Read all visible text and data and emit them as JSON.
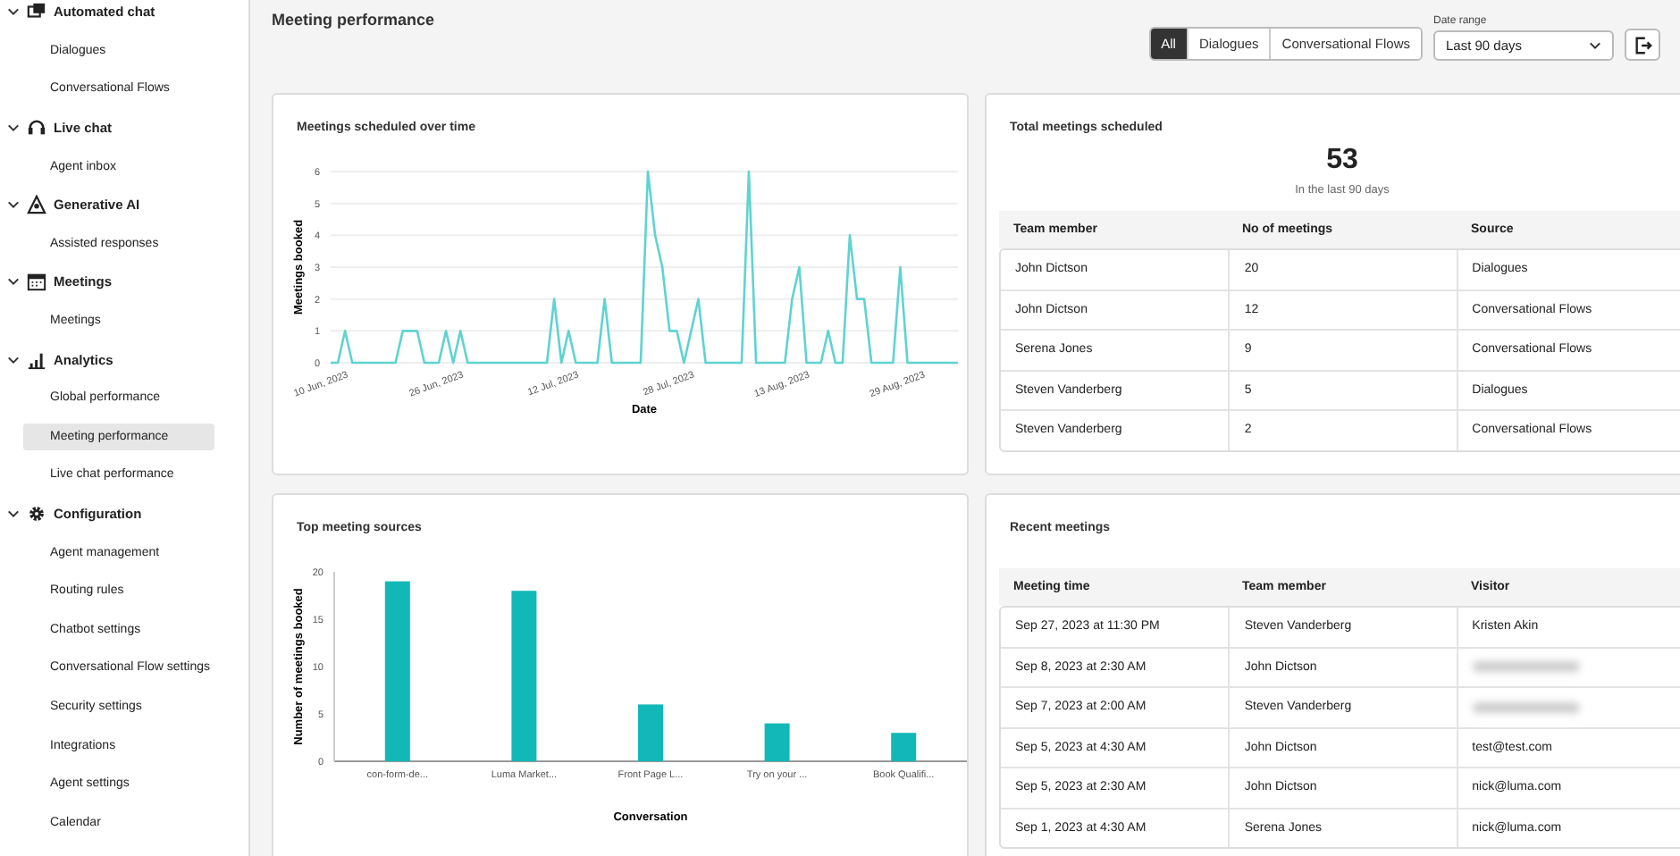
{
  "sidebar": {
    "groups": [
      {
        "label": "Automated chat",
        "expanded": true,
        "items": [
          {
            "label": "Dialogues",
            "selected": false
          },
          {
            "label": "Conversational Flows",
            "selected": false
          }
        ]
      },
      {
        "label": "Live chat",
        "expanded": true,
        "items": [
          {
            "label": "Agent inbox",
            "selected": false
          }
        ]
      },
      {
        "label": "Generative AI",
        "expanded": true,
        "items": [
          {
            "label": "Assisted responses",
            "selected": false
          }
        ]
      },
      {
        "label": "Meetings",
        "expanded": true,
        "items": [
          {
            "label": "Meetings",
            "selected": false
          }
        ]
      },
      {
        "label": "Analytics",
        "expanded": true,
        "items": [
          {
            "label": "Global performance",
            "selected": false
          },
          {
            "label": "Meeting performance",
            "selected": true
          },
          {
            "label": "Live chat performance",
            "selected": false
          }
        ]
      },
      {
        "label": "Configuration",
        "expanded": true,
        "items": [
          {
            "label": "Agent management",
            "selected": false
          },
          {
            "label": "Routing rules",
            "selected": false
          },
          {
            "label": "Chatbot settings",
            "selected": false
          },
          {
            "label": "Conversational Flow settings",
            "selected": false
          },
          {
            "label": "Security settings",
            "selected": false
          },
          {
            "label": "Integrations",
            "selected": false
          },
          {
            "label": "Agent settings",
            "selected": false
          },
          {
            "label": "Calendar",
            "selected": false
          }
        ]
      }
    ]
  },
  "header": {
    "title": "Meeting performance",
    "filters": [
      {
        "label": "All",
        "selected": true
      },
      {
        "label": "Dialogues",
        "selected": false
      },
      {
        "label": "Conversational Flows",
        "selected": false
      }
    ],
    "date_range": {
      "label": "Date range",
      "value": "Last 90 days"
    }
  },
  "meetings_over_time": {
    "title": "Meetings scheduled over time",
    "chart_data": {
      "type": "line",
      "xlabel": "Date",
      "ylabel": "Meetings booked",
      "categories": [
        null,
        null,
        "10 Jun, 2023",
        null,
        null,
        null,
        null,
        null,
        null,
        null,
        null,
        null,
        null,
        null,
        null,
        null,
        null,
        null,
        "26 Jun, 2023",
        null,
        null,
        null,
        null,
        null,
        null,
        null,
        null,
        null,
        null,
        null,
        null,
        null,
        null,
        null,
        "12 Jul, 2023",
        null,
        null,
        null,
        null,
        null,
        null,
        null,
        null,
        null,
        null,
        null,
        null,
        null,
        null,
        null,
        "28 Jul, 2023",
        null,
        null,
        null,
        null,
        null,
        null,
        null,
        null,
        null,
        null,
        null,
        null,
        null,
        null,
        null,
        "13 Aug, 2023",
        null,
        null,
        null,
        null,
        null,
        null,
        null,
        null,
        null,
        null,
        null,
        null,
        null,
        null,
        null,
        "29 Aug, 2023",
        null,
        null,
        null,
        null,
        null
      ],
      "series": [
        {
          "color": "#5fd3d0",
          "values": [
            0,
            0,
            1,
            0,
            0,
            0,
            0,
            0,
            0,
            0,
            1,
            1,
            1,
            0,
            0,
            0,
            1,
            0,
            1,
            0,
            0,
            0,
            0,
            0,
            0,
            0,
            0,
            0,
            0,
            0,
            0,
            2,
            0,
            1,
            0,
            0,
            0,
            0,
            2,
            0,
            0,
            0,
            0,
            0,
            6,
            4,
            3,
            1,
            1,
            0,
            1,
            2,
            0,
            0,
            0,
            0,
            0,
            0,
            6,
            0,
            0,
            0,
            0,
            0,
            2,
            3,
            0,
            0,
            0,
            1,
            0,
            0,
            4,
            2,
            2,
            0,
            0,
            0,
            0,
            3,
            0,
            0,
            0,
            0,
            0,
            0,
            0,
            0
          ]
        }
      ],
      "ylim": [
        0,
        6
      ],
      "grid": true,
      "yticks": [
        0,
        1,
        2,
        3,
        4,
        5,
        6
      ]
    }
  },
  "total_meetings": {
    "title": "Total meetings scheduled",
    "value": "53",
    "caption": "In the last 90 days",
    "table": {
      "columns": [
        "Team member",
        "No of meetings",
        "Source"
      ],
      "rows": [
        [
          "John Dictson",
          "20",
          "Dialogues"
        ],
        [
          "John Dictson",
          "12",
          "Conversational Flows"
        ],
        [
          "Serena Jones",
          "9",
          "Conversational Flows"
        ],
        [
          "Steven Vanderberg",
          "5",
          "Dialogues"
        ],
        [
          "Steven Vanderberg",
          "2",
          "Conversational Flows"
        ]
      ]
    }
  },
  "top_sources": {
    "title": "Top meeting sources",
    "chart_data": {
      "type": "bar",
      "xlabel": "Conversation",
      "ylabel": "Number of meetings booked",
      "categories": [
        "con-form-de...",
        "Luma Market...",
        "Front Page L...",
        "Try on your ...",
        "Book Qualifi..."
      ],
      "series": [
        {
          "color": "#12b8b8",
          "values": [
            19,
            18,
            6,
            4,
            3
          ]
        }
      ],
      "ylim": [
        0,
        20
      ],
      "yticks": [
        0,
        5,
        10,
        15,
        20
      ]
    }
  },
  "recent_meetings": {
    "title": "Recent meetings",
    "table": {
      "columns": [
        "Meeting time",
        "Team member",
        "Visitor"
      ],
      "rows": [
        {
          "cells": [
            "Sep 27, 2023 at 11:30 PM",
            "Steven Vanderberg",
            "Kristen Akin"
          ],
          "blurred": false
        },
        {
          "cells": [
            "Sep 8, 2023 at 2:30 AM",
            "John Dictson"
          ],
          "blurred": true
        },
        {
          "cells": [
            "Sep 7, 2023 at 2:00 AM",
            "Steven Vanderberg"
          ],
          "blurred": true
        },
        {
          "cells": [
            "Sep 5, 2023 at 4:30 AM",
            "John Dictson",
            "test@test.com"
          ],
          "blurred": false
        },
        {
          "cells": [
            "Sep 5, 2023 at 2:30 AM",
            "John Dictson",
            "nick@luma.com"
          ],
          "blurred": false
        },
        {
          "cells": [
            "Sep 1, 2023 at 4:30 AM",
            "Serena Jones",
            "nick@luma.com"
          ],
          "blurred": false
        }
      ]
    }
  }
}
